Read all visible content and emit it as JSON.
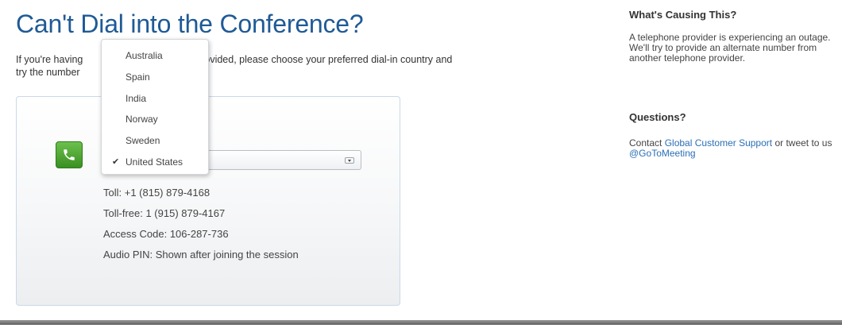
{
  "main": {
    "title": "Can't Dial into the Conference?",
    "intro_part1": "If you're having",
    "intro_part2": "number provided, please choose your preferred dial-in country and",
    "intro_part3": "try the number"
  },
  "dial_card": {
    "selected_country": "United States",
    "toll": "Toll: +1 (815) 879-4168",
    "toll_free": "Toll-free: 1 (915) 879-4167",
    "access_code": "Access Code: 106-287-736",
    "audio_pin": "Audio PIN: Shown after joining the session"
  },
  "dropdown": {
    "options": [
      "Australia",
      "Spain",
      "India",
      "Norway",
      "Sweden",
      "United States"
    ],
    "checked": "United States",
    "checkmark": "✔"
  },
  "sidebar": {
    "causing_heading": "What's Causing This?",
    "causing_text": "A telephone provider is experiencing an outage. We'll try to provide an alternate number from another telephone provider.",
    "questions_heading": "Questions?",
    "contact_prefix": "Contact ",
    "support_link": "Global Customer Support",
    "contact_middle": " or tweet to us ",
    "twitter_link": "@GoToMeeting"
  },
  "colors": {
    "title": "#1f5a96",
    "link": "#2b6fb6",
    "phone_icon": "#4aa52e",
    "card_border": "#c9d9e8"
  },
  "icons": {
    "phone": "phone-icon",
    "dropdown_arrow": "chevron-down-icon"
  }
}
